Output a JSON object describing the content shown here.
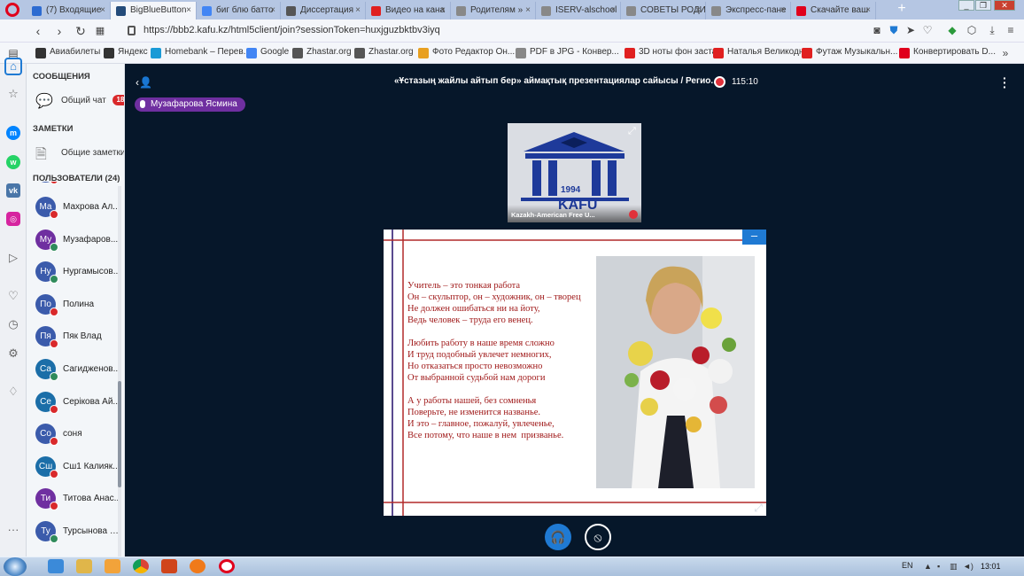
{
  "browser": {
    "tabs": [
      {
        "label": "(7) Входящие",
        "color": "#2d6bd1"
      },
      {
        "label": "BigBlueButton",
        "color": "#244b7a",
        "active": true
      },
      {
        "label": "биг блю батто",
        "color": "#4285f4"
      },
      {
        "label": "Диссертация",
        "color": "#555555"
      },
      {
        "label": "Видео на кана",
        "color": "#e02020"
      },
      {
        "label": "Родителям »",
        "color": "#888888"
      },
      {
        "label": "ISERV-alschool",
        "color": "#888888"
      },
      {
        "label": "СОВЕТЫ РОДИ",
        "color": "#888888"
      },
      {
        "label": "Экспресс-пане",
        "color": "#888888"
      },
      {
        "label": "Скачайте ваш",
        "color": "#e0001c"
      }
    ],
    "url": "https://bbb2.kafu.kz/html5client/join?sessionToken=huxjguzbktbv3iyq",
    "bookmarks": [
      {
        "label": "Авиабилеты",
        "color": "#333333"
      },
      {
        "label": "Яндекс",
        "color": "#333333"
      },
      {
        "label": "Homebank – Перев...",
        "color": "#1a9ad6"
      },
      {
        "label": "Google",
        "color": "#4285f4"
      },
      {
        "label": "Zhastar.org",
        "color": "#555555"
      },
      {
        "label": "Zhastar.org",
        "color": "#555555"
      },
      {
        "label": "Фото Редактор Он...",
        "color": "#e8a020"
      },
      {
        "label": "PDF в JPG - Конвер...",
        "color": "#888888"
      },
      {
        "label": "3D ноты фон заста...",
        "color": "#e02020"
      },
      {
        "label": "Наталья Великодн...",
        "color": "#e02020"
      },
      {
        "label": "Футаж Музыкальн...",
        "color": "#e02020"
      },
      {
        "label": "Конвертировать D...",
        "color": "#e0001c"
      }
    ]
  },
  "panel": {
    "messages_header": "СООБЩЕНИЯ",
    "public_chat": "Общий чат",
    "chat_unread": "18",
    "notes_header": "ЗАМЕТКИ",
    "shared_notes": "Общие заметки",
    "users_header": "ПОЛЬЗОВАТЕЛИ (24)",
    "users": [
      {
        "initials": "Ма",
        "name": "Махрова Ал...",
        "color": "#3b5bab",
        "status": "muted"
      },
      {
        "initials": "Му",
        "name": "Музафаров...",
        "color": "#6f2fa0",
        "status": "talking"
      },
      {
        "initials": "Ну",
        "name": "Нургамысов...",
        "color": "#3b5bab",
        "status": "talking"
      },
      {
        "initials": "По",
        "name": "Полина",
        "color": "#3b5bab",
        "status": "muted"
      },
      {
        "initials": "Пя",
        "name": "Пяк Влад",
        "color": "#3b5bab",
        "status": "muted"
      },
      {
        "initials": "Са",
        "name": "Сагидженов...",
        "color": "#1b6ea8",
        "status": "talking"
      },
      {
        "initials": "Се",
        "name": "Серікова Ай...",
        "color": "#1b6ea8",
        "status": "muted"
      },
      {
        "initials": "Со",
        "name": "соня",
        "color": "#3b5bab",
        "status": "muted"
      },
      {
        "initials": "Сш",
        "name": "Сш1 Калияк...",
        "color": "#1b6ea8",
        "status": "muted"
      },
      {
        "initials": "Ти",
        "name": "Титова Анас...",
        "color": "#6f2fa0",
        "status": "muted"
      },
      {
        "initials": "Ту",
        "name": "Турсынова А...",
        "color": "#3b5bab",
        "status": "talking"
      }
    ]
  },
  "meeting": {
    "title": "«Ұстазың жайлы айтып бер» аймақтық презентациялар сайысы / Регио...",
    "elapsed": "115:10",
    "talker": "Музафарова Ясмина",
    "webcam_name": "Kazakh-American Free U...",
    "webcam_logo_year": "1994",
    "webcam_logo_text": "KAFU"
  },
  "slide": {
    "poem": "Учитель – это тонкая работа\nОн – скульптор, он – художник, он – творец\nНе должен ошибаться ни на йоту,\nВедь человек – труда его венец.\n\nЛюбить работу в наше время сложно\nИ труд подобный увлечет немногих,\nНо отказаться просто невозможно\nОт выбранной судьбой нам дороги\n\nА у работы нашей, без сомненья\nПоверьте, не изменится названье.\nИ это – главное, пожалуй, увлеченье,\nВсе потому, что наше в нем  призванье."
  },
  "taskbar": {
    "lang": "EN",
    "time": "13:01"
  },
  "colors": {
    "bbb_background": "#06172a",
    "primary": "#1f7ad3",
    "muted_red": "#d9292b",
    "talking_green": "#2f8b5b",
    "poem_red": "#a01a1a"
  }
}
